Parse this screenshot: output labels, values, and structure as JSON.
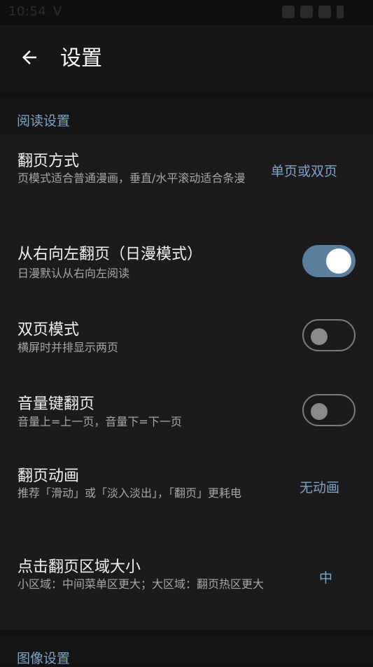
{
  "status_bar": {
    "time": "10:54",
    "carrier_glyph": "V",
    "icons": [
      "link-icon",
      "wifi-icon",
      "signal-icon",
      "battery-icon"
    ]
  },
  "app_bar": {
    "title": "设置",
    "back_icon": "arrow-left-icon"
  },
  "sections": [
    {
      "header": "阅读设置",
      "items": [
        {
          "title": "翻页方式",
          "subtitle": "页模式适合普通漫画，垂直/水平滚动适合条漫",
          "value": "单页或双页"
        },
        {
          "title": "从右向左翻页（日漫模式）",
          "subtitle": "日漫默认从右向左阅读",
          "toggle": true
        },
        {
          "title": "双页模式",
          "subtitle": "横屏时并排显示两页",
          "toggle": false
        },
        {
          "title": "音量键翻页",
          "subtitle": "音量上=上一页，音量下=下一页",
          "toggle": false
        },
        {
          "title": "翻页动画",
          "subtitle": "推荐「滑动」或「淡入淡出」，「翻页」更耗电",
          "value": "无动画"
        },
        {
          "title": "点击翻页区域大小",
          "subtitle": "小区域：中间菜单区更大；大区域：翻页热区更大",
          "value": "中"
        }
      ]
    },
    {
      "header": "图像设置",
      "items": []
    }
  ],
  "colors": {
    "background": "#121214",
    "card": "#1b1b1d",
    "accent": "#7ea3c4",
    "toggle_on_track": "#5b7e9e",
    "toggle_off_outline": "#7a7a7a"
  }
}
